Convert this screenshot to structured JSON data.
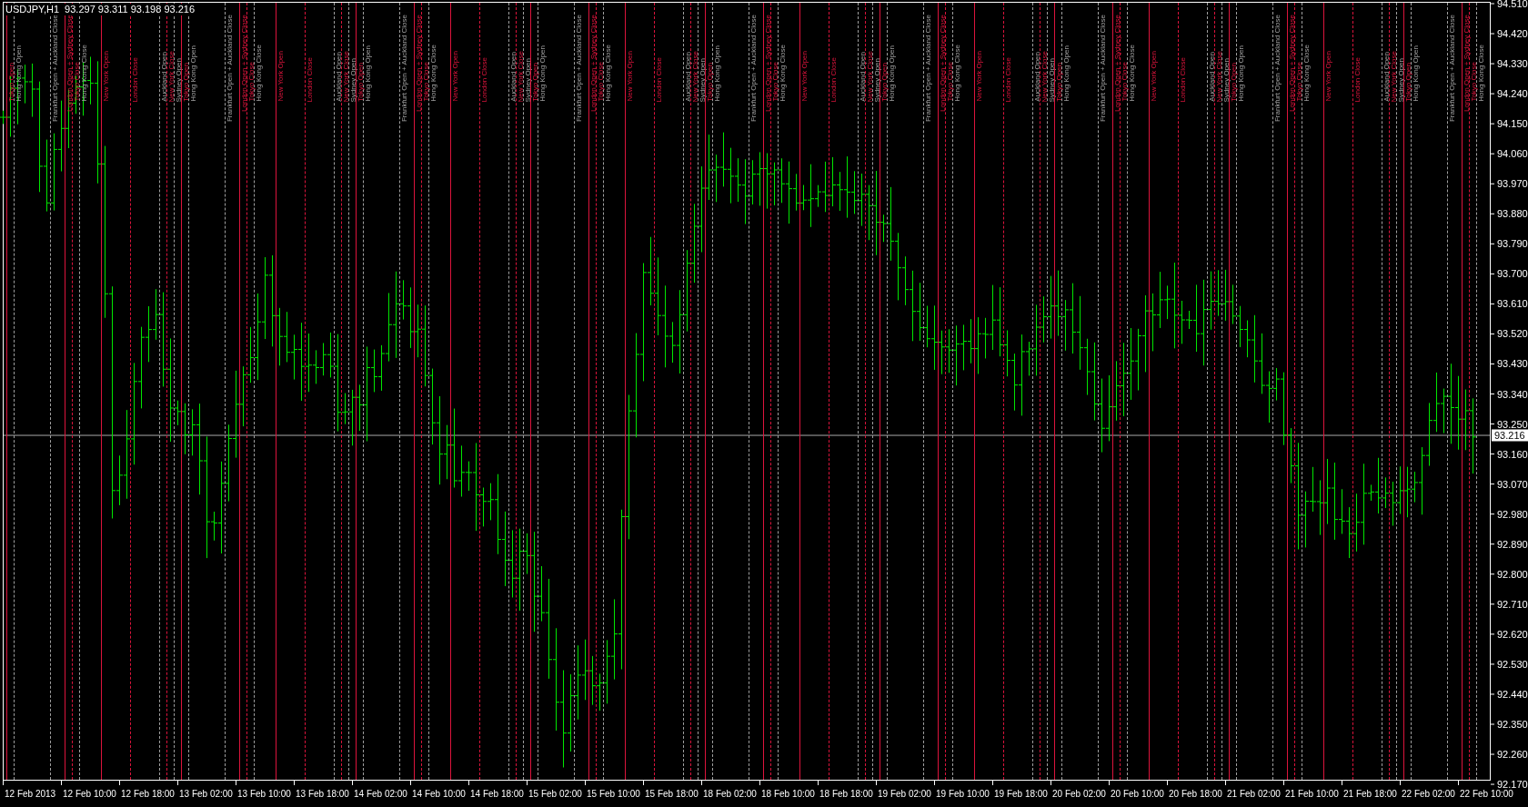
{
  "chart": {
    "symbol": "USDJPY,H1",
    "quote": "93.297 93.311 93.198 93.216",
    "current_price": "93.216",
    "price_axis": [
      "94.510",
      "94.420",
      "94.330",
      "94.240",
      "94.150",
      "94.060",
      "93.970",
      "93.880",
      "93.790",
      "93.700",
      "93.610",
      "93.520",
      "93.430",
      "93.340",
      "93.250",
      "93.160",
      "93.070",
      "92.980",
      "92.890",
      "92.800",
      "92.710",
      "92.620",
      "92.530",
      "92.440",
      "92.350",
      "92.260",
      "92.170"
    ],
    "time_axis": [
      "12 Feb 2013",
      "12 Feb 10:00",
      "12 Feb 18:00",
      "13 Feb 02:00",
      "13 Feb 10:00",
      "13 Feb 18:00",
      "14 Feb 02:00",
      "14 Feb 10:00",
      "14 Feb 18:00",
      "15 Feb 02:00",
      "15 Feb 10:00",
      "15 Feb 18:00",
      "18 Feb 02:00",
      "18 Feb 10:00",
      "18 Feb 18:00",
      "19 Feb 02:00",
      "19 Feb 10:00",
      "19 Feb 18:00",
      "20 Feb 02:00",
      "20 Feb 10:00",
      "20 Feb 18:00",
      "21 Feb 02:00",
      "21 Feb 10:00",
      "21 Feb 18:00",
      "22 Feb 02:00",
      "22 Feb 10:00"
    ],
    "markers": [
      {
        "kind": "tokyo_open",
        "label": "Tokyo Open",
        "color": "#dc143c",
        "dashed": false
      },
      {
        "kind": "hk_open",
        "label": "Hong Kong Open",
        "color": "#a0a0a0",
        "dashed": true
      },
      {
        "kind": "frankfurt_open",
        "label": "Frankfurt Open + Auckland Close",
        "color": "#a0a0a0",
        "dashed": true
      },
      {
        "kind": "london_open",
        "label": "London Open + Sydney Close",
        "color": "#dc143c",
        "dashed": false
      },
      {
        "kind": "tokyo_close",
        "label": "Tokyo Close",
        "color": "#dc143c",
        "dashed": true
      },
      {
        "kind": "hk_close",
        "label": "Hong Kong Close",
        "color": "#a0a0a0",
        "dashed": true
      },
      {
        "kind": "ny_open",
        "label": "New York Open",
        "color": "#dc143c",
        "dashed": false
      },
      {
        "kind": "london_close",
        "label": "London Close",
        "color": "#dc143c",
        "dashed": true
      },
      {
        "kind": "auckland_open",
        "label": "Auckland Open",
        "color": "#a0a0a0",
        "dashed": true
      },
      {
        "kind": "ny_close",
        "label": "New York Close",
        "color": "#dc143c",
        "dashed": true
      },
      {
        "kind": "sydney_open",
        "label": "Sydney Open",
        "color": "#a0a0a0",
        "dashed": true
      },
      {
        "kind": "tokyo_open",
        "label": "Tokyo Open",
        "color": "#dc143c",
        "dashed": false
      },
      {
        "kind": "hk_open",
        "label": "Hong Kong Open",
        "color": "#a0a0a0",
        "dashed": true
      },
      {
        "kind": "frankfurt_open",
        "label": "Frankfurt Open + Auckland Close",
        "color": "#a0a0a0",
        "dashed": true
      },
      {
        "kind": "london_open",
        "label": "London Open + Sydney Close",
        "color": "#dc143c",
        "dashed": false
      },
      {
        "kind": "tokyo_close",
        "label": "Tokyo Close",
        "color": "#dc143c",
        "dashed": true
      },
      {
        "kind": "hk_close",
        "label": "Hong Kong Close",
        "color": "#a0a0a0",
        "dashed": true
      },
      {
        "kind": "ny_open",
        "label": "New York Open",
        "color": "#dc143c",
        "dashed": false
      },
      {
        "kind": "london_close",
        "label": "London Close",
        "color": "#dc143c",
        "dashed": true
      },
      {
        "kind": "auckland_open",
        "label": "Auckland Open",
        "color": "#a0a0a0",
        "dashed": true
      },
      {
        "kind": "ny_close",
        "label": "New York Close",
        "color": "#dc143c",
        "dashed": true
      },
      {
        "kind": "sydney_open",
        "label": "Sydney Open",
        "color": "#a0a0a0",
        "dashed": true
      },
      {
        "kind": "tokyo_open",
        "label": "Tokyo Open",
        "color": "#dc143c",
        "dashed": false
      },
      {
        "kind": "hk_open",
        "label": "Hong Kong Open",
        "color": "#a0a0a0",
        "dashed": true
      },
      {
        "kind": "frankfurt_open",
        "label": "Frankfurt Open + Auckland Close",
        "color": "#a0a0a0",
        "dashed": true
      },
      {
        "kind": "london_open",
        "label": "London Open + Sydney Close",
        "color": "#dc143c",
        "dashed": false
      },
      {
        "kind": "tokyo_close",
        "label": "Tokyo Close",
        "color": "#dc143c",
        "dashed": true
      },
      {
        "kind": "hk_close",
        "label": "Hong Kong Close",
        "color": "#a0a0a0",
        "dashed": true
      },
      {
        "kind": "ny_open",
        "label": "New York Open",
        "color": "#dc143c",
        "dashed": false
      },
      {
        "kind": "london_close",
        "label": "London Close",
        "color": "#dc143c",
        "dashed": true
      },
      {
        "kind": "auckland_open",
        "label": "Auckland Open",
        "color": "#a0a0a0",
        "dashed": true
      },
      {
        "kind": "ny_close",
        "label": "New York Close",
        "color": "#dc143c",
        "dashed": true
      },
      {
        "kind": "sydney_open",
        "label": "Sydney Open",
        "color": "#a0a0a0",
        "dashed": true
      },
      {
        "kind": "tokyo_open",
        "label": "Tokyo Open",
        "color": "#dc143c",
        "dashed": false
      },
      {
        "kind": "hk_open",
        "label": "Hong Kong Open",
        "color": "#a0a0a0",
        "dashed": true
      },
      {
        "kind": "frankfurt_open",
        "label": "Frankfurt Open + Auckland Close",
        "color": "#a0a0a0",
        "dashed": true
      },
      {
        "kind": "london_open",
        "label": "London Open + Sydney Close",
        "color": "#dc143c",
        "dashed": false
      },
      {
        "kind": "tokyo_close",
        "label": "Tokyo Close",
        "color": "#dc143c",
        "dashed": true
      },
      {
        "kind": "hk_close",
        "label": "Hong Kong Close",
        "color": "#a0a0a0",
        "dashed": true
      },
      {
        "kind": "ny_open",
        "label": "New York Open",
        "color": "#dc143c",
        "dashed": false
      },
      {
        "kind": "london_close",
        "label": "London Close",
        "color": "#dc143c",
        "dashed": true
      },
      {
        "kind": "auckland_open",
        "label": "Auckland Open",
        "color": "#a0a0a0",
        "dashed": true
      },
      {
        "kind": "ny_close",
        "label": "New York Close",
        "color": "#dc143c",
        "dashed": true
      },
      {
        "kind": "sydney_open",
        "label": "Sydney Open",
        "color": "#a0a0a0",
        "dashed": true
      },
      {
        "kind": "tokyo_open",
        "label": "Tokyo Open",
        "color": "#dc143c",
        "dashed": false
      },
      {
        "kind": "hk_open",
        "label": "Hong Kong Open",
        "color": "#a0a0a0",
        "dashed": true
      },
      {
        "kind": "frankfurt_open",
        "label": "Frankfurt Open + Auckland Close",
        "color": "#a0a0a0",
        "dashed": true
      },
      {
        "kind": "london_open",
        "label": "London Open + Sydney Close",
        "color": "#dc143c",
        "dashed": false
      },
      {
        "kind": "tokyo_close",
        "label": "Tokyo Close",
        "color": "#dc143c",
        "dashed": true
      },
      {
        "kind": "hk_close",
        "label": "Hong Kong Close",
        "color": "#a0a0a0",
        "dashed": true
      },
      {
        "kind": "ny_open",
        "label": "New York Open",
        "color": "#dc143c",
        "dashed": false
      },
      {
        "kind": "london_close",
        "label": "London Close",
        "color": "#dc143c",
        "dashed": true
      },
      {
        "kind": "auckland_open",
        "label": "Auckland Open",
        "color": "#a0a0a0",
        "dashed": true
      },
      {
        "kind": "ny_close",
        "label": "New York Close",
        "color": "#dc143c",
        "dashed": true
      },
      {
        "kind": "sydney_open",
        "label": "Sydney Open",
        "color": "#a0a0a0",
        "dashed": true
      },
      {
        "kind": "tokyo_open",
        "label": "Tokyo Open",
        "color": "#dc143c",
        "dashed": false
      },
      {
        "kind": "hk_open",
        "label": "Hong Kong Open",
        "color": "#a0a0a0",
        "dashed": true
      },
      {
        "kind": "frankfurt_open",
        "label": "Frankfurt Open + Auckland Close",
        "color": "#a0a0a0",
        "dashed": true
      },
      {
        "kind": "london_open",
        "label": "London Open + Sydney Close",
        "color": "#dc143c",
        "dashed": false
      },
      {
        "kind": "tokyo_close",
        "label": "Tokyo Close",
        "color": "#dc143c",
        "dashed": true
      },
      {
        "kind": "hk_close",
        "label": "Hong Kong Close",
        "color": "#a0a0a0",
        "dashed": true
      },
      {
        "kind": "ny_open",
        "label": "New York Open",
        "color": "#dc143c",
        "dashed": false
      },
      {
        "kind": "london_close",
        "label": "London Close",
        "color": "#dc143c",
        "dashed": true
      },
      {
        "kind": "auckland_open",
        "label": "Auckland Open",
        "color": "#a0a0a0",
        "dashed": true
      },
      {
        "kind": "ny_close",
        "label": "New York Close",
        "color": "#dc143c",
        "dashed": true
      },
      {
        "kind": "sydney_open",
        "label": "Sydney Open",
        "color": "#a0a0a0",
        "dashed": true
      },
      {
        "kind": "tokyo_open",
        "label": "Tokyo Open",
        "color": "#dc143c",
        "dashed": false
      },
      {
        "kind": "hk_open",
        "label": "Hong Kong Open",
        "color": "#a0a0a0",
        "dashed": true
      },
      {
        "kind": "frankfurt_open",
        "label": "Frankfurt Open + Auckland Close",
        "color": "#a0a0a0",
        "dashed": true
      },
      {
        "kind": "london_open",
        "label": "London Open + Sydney Close",
        "color": "#dc143c",
        "dashed": false
      },
      {
        "kind": "tokyo_close",
        "label": "Tokyo Close",
        "color": "#dc143c",
        "dashed": true
      },
      {
        "kind": "hk_close",
        "label": "Hong Kong Close",
        "color": "#a0a0a0",
        "dashed": true
      },
      {
        "kind": "ny_open",
        "label": "New York Open",
        "color": "#dc143c",
        "dashed": false
      },
      {
        "kind": "london_close",
        "label": "London Close",
        "color": "#dc143c",
        "dashed": true
      },
      {
        "kind": "auckland_open",
        "label": "Auckland Open",
        "color": "#a0a0a0",
        "dashed": true
      },
      {
        "kind": "ny_close",
        "label": "New York Close",
        "color": "#dc143c",
        "dashed": true
      },
      {
        "kind": "sydney_open",
        "label": "Sydney Open",
        "color": "#a0a0a0",
        "dashed": true
      },
      {
        "kind": "tokyo_open",
        "label": "Tokyo Open",
        "color": "#dc143c",
        "dashed": false
      },
      {
        "kind": "hk_open",
        "label": "Hong Kong Open",
        "color": "#a0a0a0",
        "dashed": true
      },
      {
        "kind": "frankfurt_open",
        "label": "Frankfurt Open + Auckland Close",
        "color": "#a0a0a0",
        "dashed": true
      },
      {
        "kind": "london_open",
        "label": "London Open + Sydney Close",
        "color": "#dc143c",
        "dashed": false
      },
      {
        "kind": "tokyo_close",
        "label": "Tokyo Close",
        "color": "#dc143c",
        "dashed": true
      },
      {
        "kind": "hk_close",
        "label": "Hong Kong Close",
        "color": "#a0a0a0",
        "dashed": true
      },
      {
        "kind": "ny_open",
        "label": "New York Open",
        "color": "#dc143c",
        "dashed": false
      },
      {
        "kind": "london_close",
        "label": "London Close",
        "color": "#dc143c",
        "dashed": true
      },
      {
        "kind": "auckland_open",
        "label": "Auckland Open",
        "color": "#a0a0a0",
        "dashed": true
      },
      {
        "kind": "ny_close",
        "label": "New York Close",
        "color": "#dc143c",
        "dashed": true
      },
      {
        "kind": "sydney_open",
        "label": "Sydney Open",
        "color": "#a0a0a0",
        "dashed": true
      },
      {
        "kind": "tokyo_open",
        "label": "Tokyo Open",
        "color": "#dc143c",
        "dashed": false
      },
      {
        "kind": "hk_open",
        "label": "Hong Kong Open",
        "color": "#a0a0a0",
        "dashed": true
      },
      {
        "kind": "frankfurt_open",
        "label": "Frankfurt Open + Auckland Close",
        "color": "#a0a0a0",
        "dashed": true
      },
      {
        "kind": "london_open",
        "label": "London Open + Sydney Close",
        "color": "#dc143c",
        "dashed": false
      },
      {
        "kind": "tokyo_close",
        "label": "Tokyo Close",
        "color": "#dc143c",
        "dashed": true
      },
      {
        "kind": "hk_close",
        "label": "Hong Kong Close",
        "color": "#a0a0a0",
        "dashed": true
      }
    ]
  }
}
